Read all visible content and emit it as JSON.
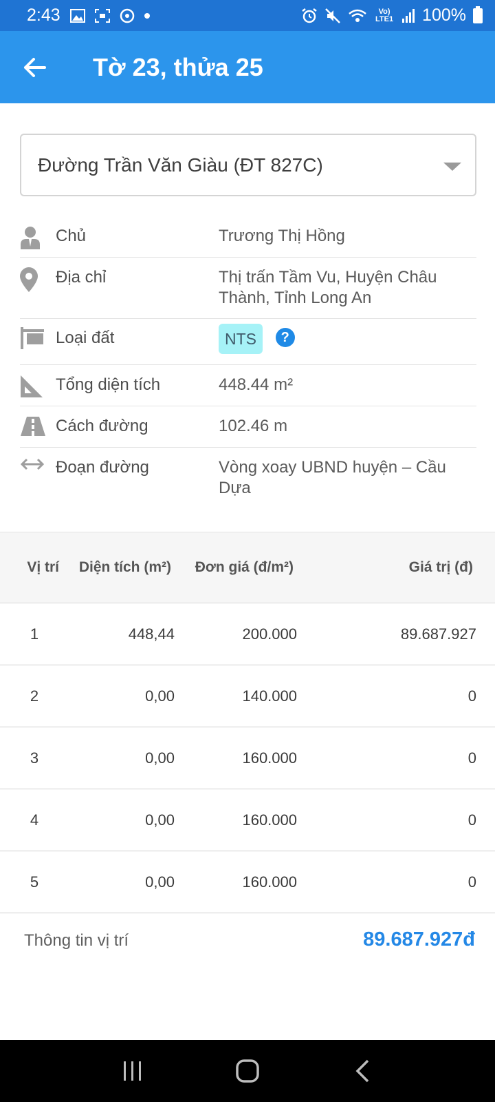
{
  "status_bar": {
    "time": "2:43",
    "battery": "100%",
    "network_label": "Vo) LTE1"
  },
  "header": {
    "title": "Tờ 23, thửa 25"
  },
  "road_select": {
    "value": "Đường Trần Văn Giàu (ĐT 827C)"
  },
  "info": {
    "owner_label": "Chủ",
    "owner_value": "Trương Thị Hồng",
    "address_label": "Địa chỉ",
    "address_value": "Thị trấn Tầm Vu, Huyện Châu Thành, Tỉnh Long An",
    "land_type_label": "Loại đất",
    "land_type_value": "NTS",
    "area_label": "Tổng diện tích",
    "area_value": "448.44 m²",
    "distance_label": "Cách đường",
    "distance_value": "102.46 m",
    "segment_label": "Đoạn đường",
    "segment_value": "Vòng xoay UBND huyện – Cầu Dựa"
  },
  "table": {
    "headers": [
      "Vị trí",
      "Diện tích (m²)",
      "Đơn giá (đ/m²)",
      "Giá trị (đ)"
    ],
    "rows": [
      [
        "1",
        "448,44",
        "200.000",
        "89.687.927"
      ],
      [
        "2",
        "0,00",
        "140.000",
        "0"
      ],
      [
        "3",
        "0,00",
        "160.000",
        "0"
      ],
      [
        "4",
        "0,00",
        "160.000",
        "0"
      ],
      [
        "5",
        "0,00",
        "160.000",
        "0"
      ]
    ]
  },
  "footer": {
    "label": "Thông tin vị trí",
    "total": "89.687.927đ"
  },
  "colors": {
    "status_bar": "#1f74d3",
    "app_bar": "#2c95ec",
    "accent": "#2488e6",
    "badge": "#a6f2f7"
  }
}
